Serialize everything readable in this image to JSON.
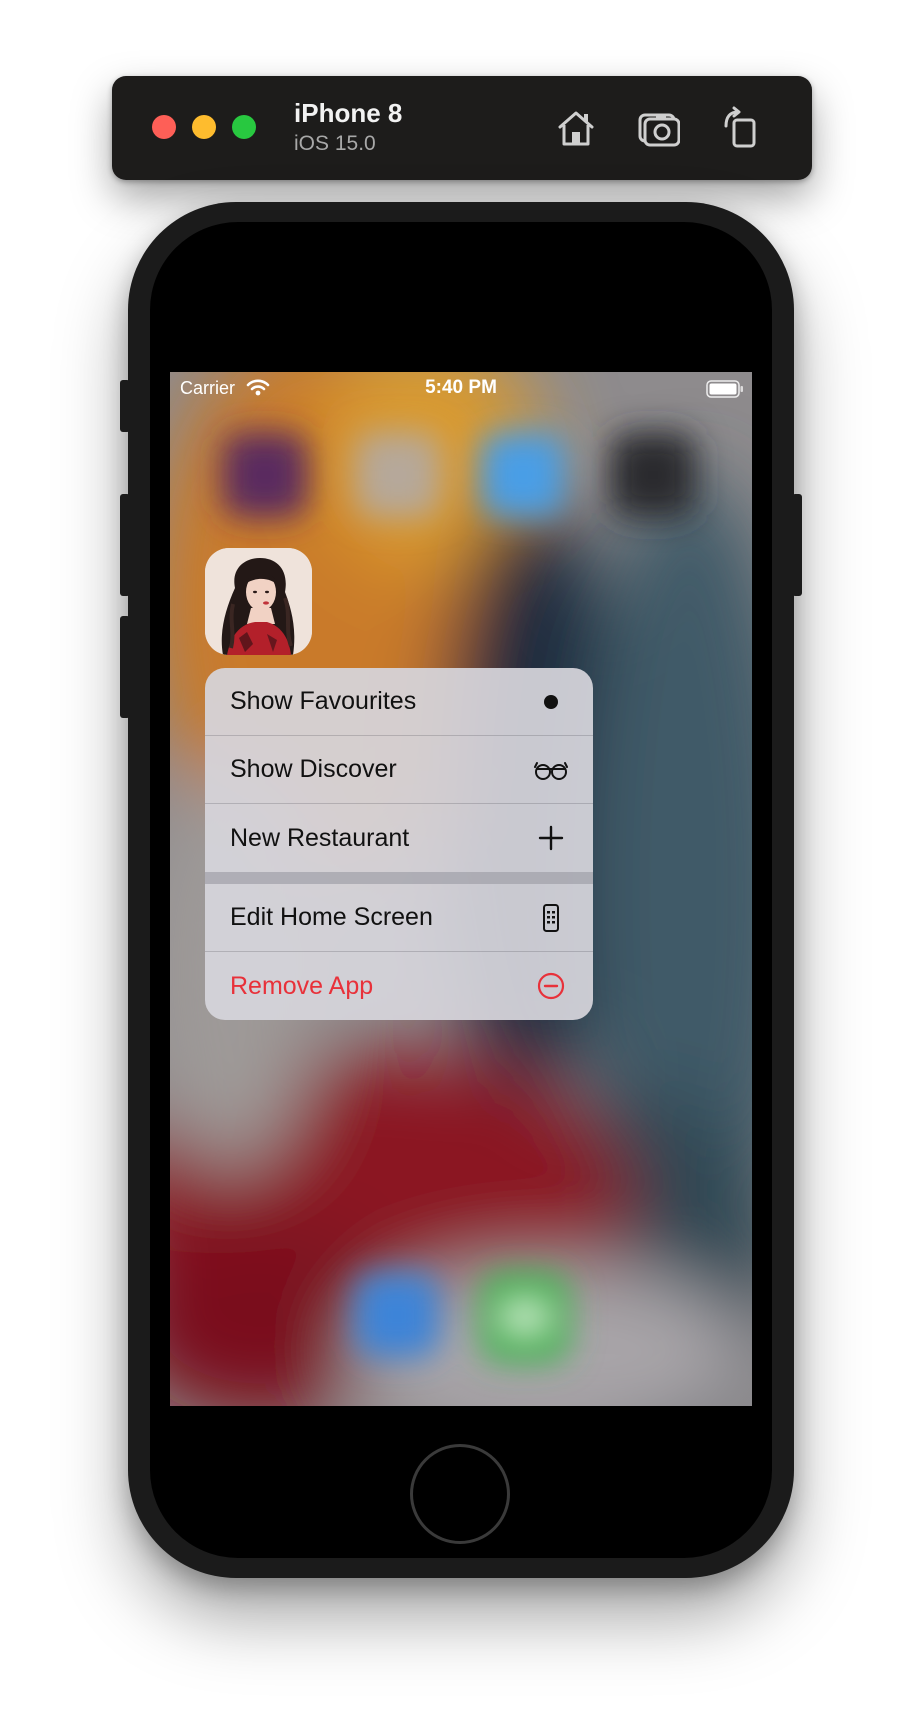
{
  "simulator": {
    "device_name": "iPhone 8",
    "os_version": "iOS 15.0",
    "toolbar_icons": [
      "home-icon",
      "screenshot-icon",
      "rotate-icon"
    ]
  },
  "status_bar": {
    "carrier": "Carrier",
    "time": "5:40 PM",
    "icons": [
      "wifi-icon",
      "battery-icon"
    ]
  },
  "app": {
    "icon": "avatar-portrait-icon"
  },
  "context_menu": {
    "items": [
      {
        "label": "Show Favourites",
        "icon": "filled-circle-icon",
        "destructive": false
      },
      {
        "label": "Show Discover",
        "icon": "eyeglasses-icon",
        "destructive": false
      },
      {
        "label": "New Restaurant",
        "icon": "plus-icon",
        "destructive": false
      },
      {
        "label": "Edit Home Screen",
        "icon": "iphone-icon",
        "destructive": false
      },
      {
        "label": "Remove App",
        "icon": "minus-circle-icon",
        "destructive": true
      }
    ]
  },
  "colors": {
    "destructive": "#e8313a",
    "toolbar_bg": "#1d1c1b",
    "traffic_red": "#fe5f57",
    "traffic_yellow": "#febc2e",
    "traffic_green": "#28c840"
  }
}
